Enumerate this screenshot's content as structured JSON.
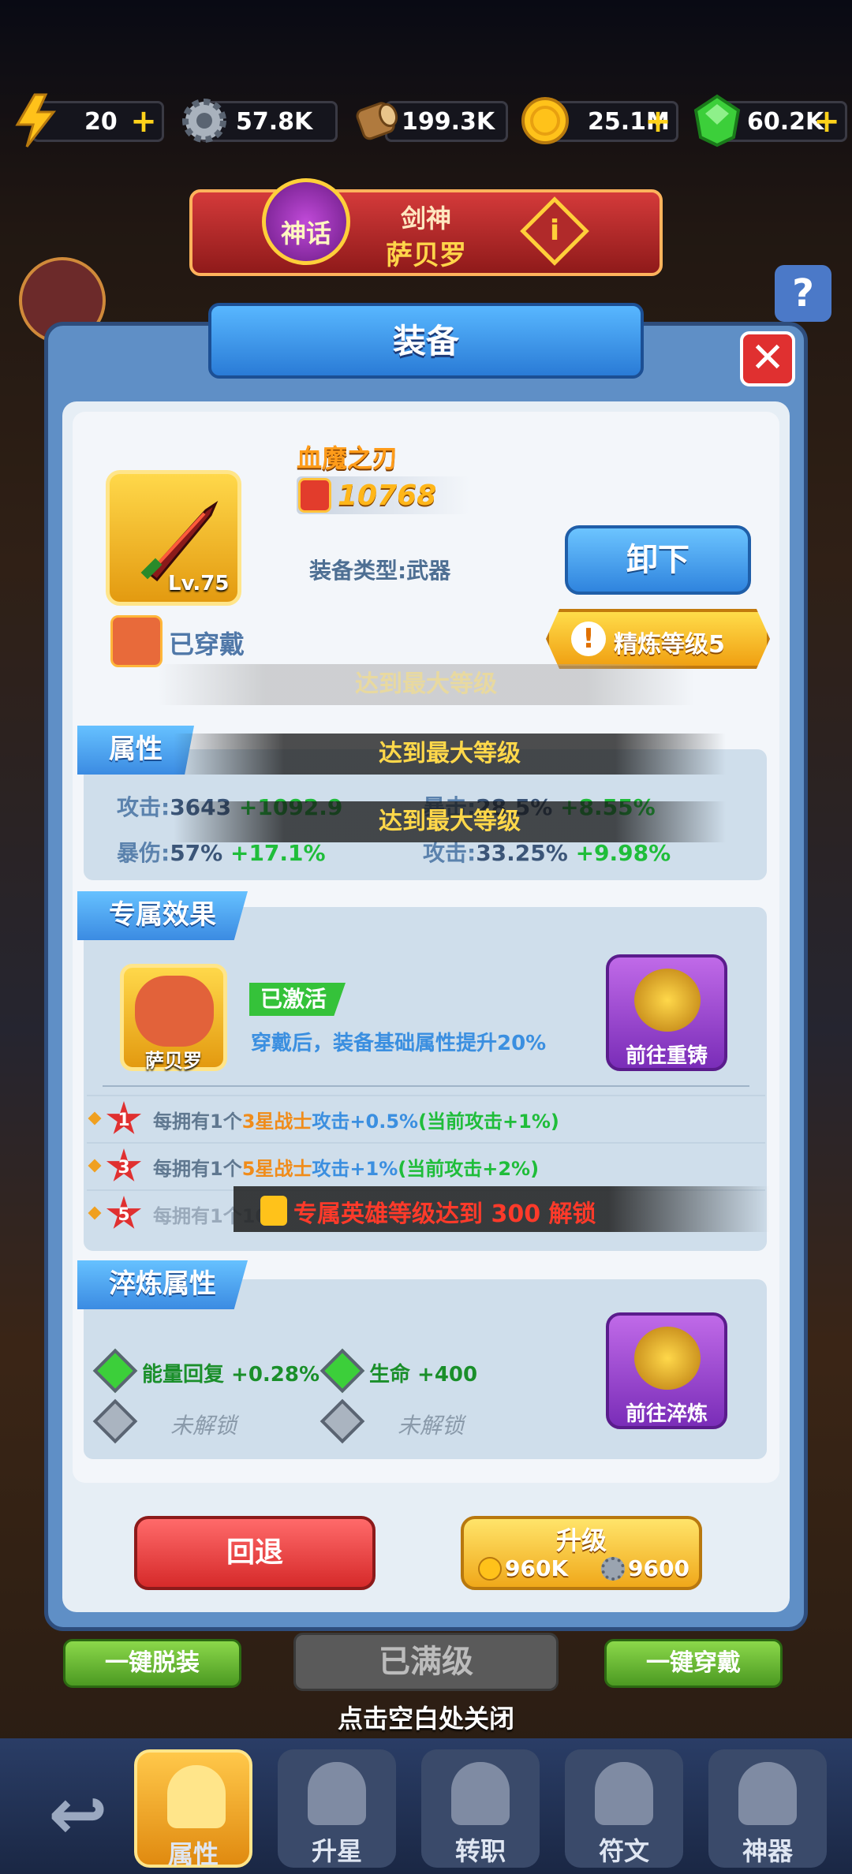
{
  "resources": [
    {
      "icon": "energy-icon",
      "value": "20",
      "has_plus": true
    },
    {
      "icon": "gear-icon",
      "value": "57.8K",
      "has_plus": false
    },
    {
      "icon": "wood-icon",
      "value": "199.3K",
      "has_plus": false
    },
    {
      "icon": "gold-coin-icon",
      "value": "25.1M",
      "has_plus": true
    },
    {
      "icon": "gem-icon",
      "value": "60.2K",
      "has_plus": true
    }
  ],
  "hero_banner": {
    "rank": "神话",
    "title": "剑神",
    "name": "萨贝罗"
  },
  "panel": {
    "title": "装备"
  },
  "item": {
    "name": "血魔之刃",
    "power": "10768",
    "level": "Lv.75",
    "type_label": "装备类型:武器",
    "equipped_label": "已穿戴",
    "unequip_label": "卸下",
    "refine_label": "精炼等级5",
    "max_level_notice": "达到最大等级"
  },
  "attributes": {
    "tab": "属性",
    "overlay_1": "达到最大等级",
    "overlay_2": "达到最大等级",
    "items": [
      {
        "label": "攻击:",
        "value": "3643",
        "bonus": "+1092.9"
      },
      {
        "label": "暴击:",
        "value": "28.5%",
        "bonus": "+8.55%"
      },
      {
        "label": "暴伤:",
        "value": "57%",
        "bonus": "+17.1%"
      },
      {
        "label": "攻击:",
        "value": "33.25%",
        "bonus": "+9.98%"
      }
    ]
  },
  "exclusive": {
    "tab": "专属效果",
    "hero_name": "萨贝罗",
    "activated": "已激活",
    "description": "穿戴后，装备基础属性提升20%",
    "reforge_button": "前往重铸",
    "rows": [
      {
        "star": "1",
        "prefix": "每拥有1个",
        "highlight": "3星战士",
        "effect": "攻击+0.5%",
        "note": "(当前攻击+1%)"
      },
      {
        "star": "3",
        "prefix": "每拥有1个",
        "highlight": "5星战士",
        "effect": "攻击+1%",
        "note": "(当前攻击+2%)"
      },
      {
        "star": "5",
        "prefix": "每拥有1个10"
      }
    ],
    "lock_text": "专属英雄等级达到 300 解锁"
  },
  "quench": {
    "tab": "淬炼属性",
    "stat_1": "能量回复 +0.28%",
    "stat_2": "生命 +400",
    "locked_1": "未解锁",
    "locked_2": "未解锁",
    "button": "前往淬炼"
  },
  "actions": {
    "back": "回退",
    "upgrade": "升级",
    "coin_cost": "960K",
    "gear_cost": "9600"
  },
  "below": {
    "unequip_all": "一键脱装",
    "maxed": "已满级",
    "equip_all": "一键穿戴",
    "close_hint": "点击空白处关闭"
  },
  "nav": {
    "items": [
      {
        "label": "属性",
        "icon": "helmet-icon",
        "active": true
      },
      {
        "label": "升星",
        "icon": "star-icon",
        "active": false
      },
      {
        "label": "转职",
        "icon": "sword-icon",
        "active": false
      },
      {
        "label": "符文",
        "icon": "rune-icon",
        "active": false
      },
      {
        "label": "神器",
        "icon": "artifact-icon",
        "active": false
      }
    ]
  }
}
